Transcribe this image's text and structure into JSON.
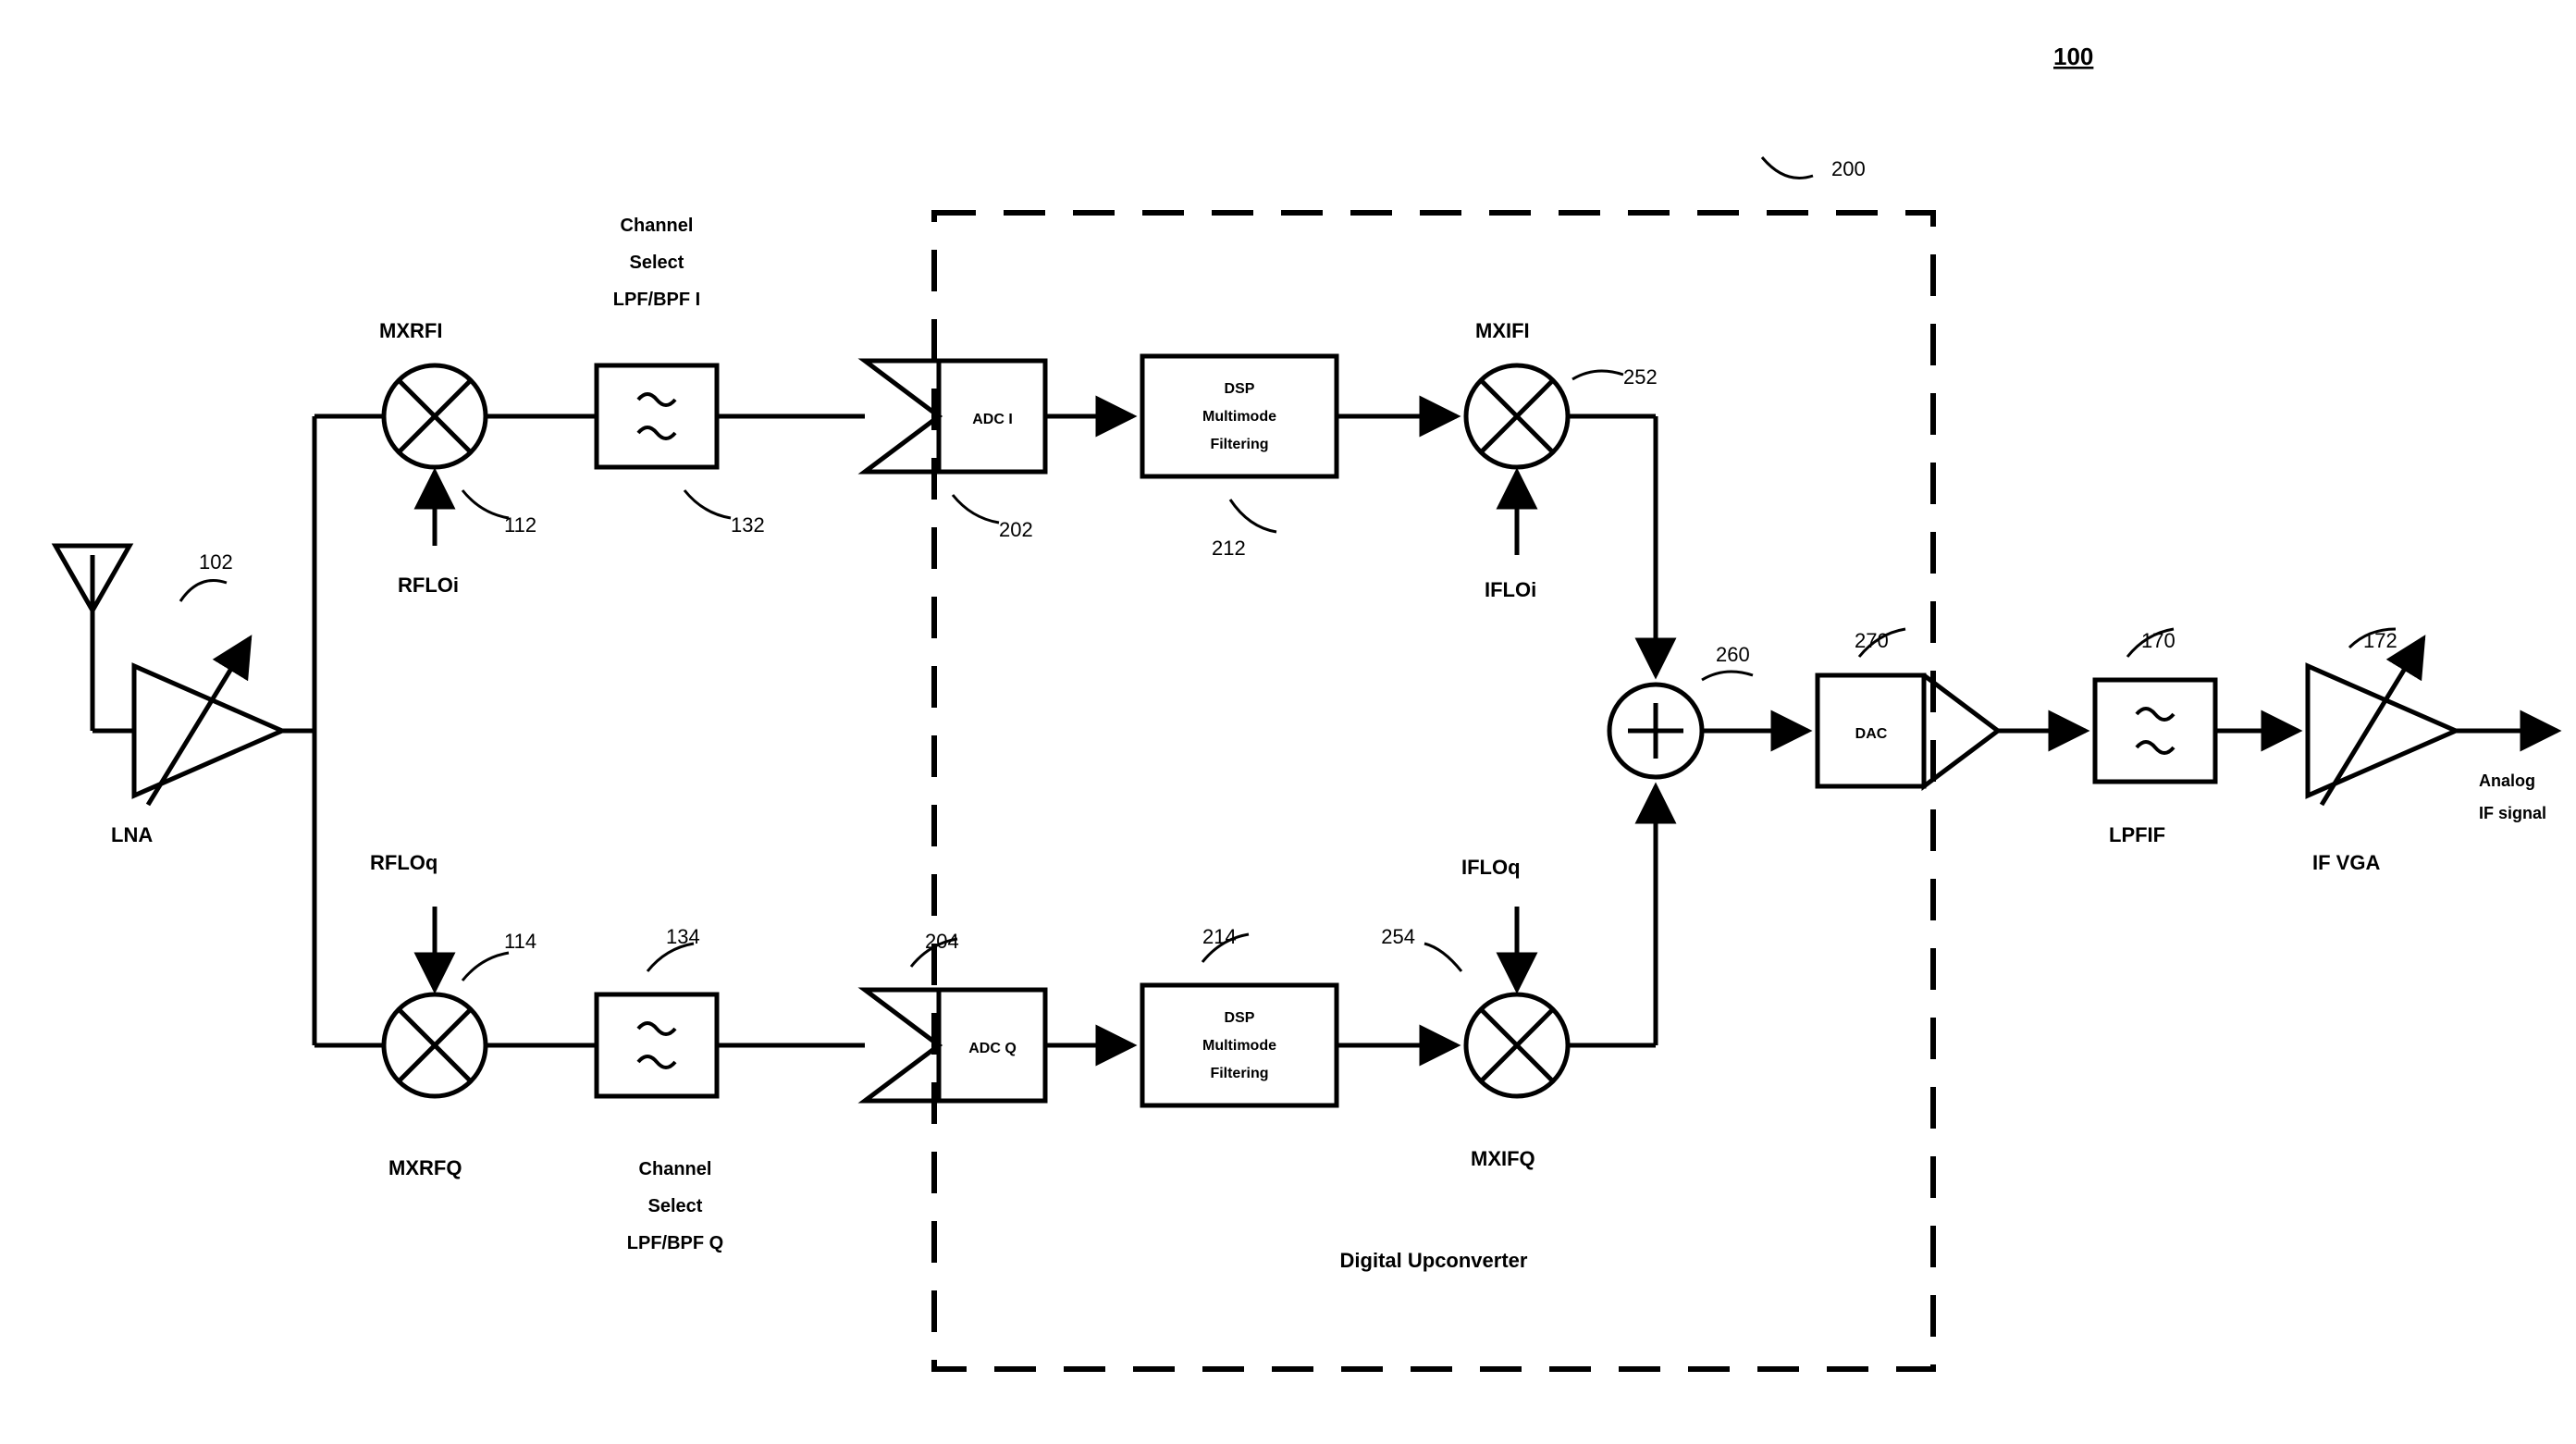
{
  "figure_ref": "100",
  "dashed_ref": "200",
  "section_title": "Digital Upconverter",
  "antenna": {
    "ref": "102"
  },
  "lna": {
    "label": "LNA"
  },
  "mixers": {
    "rfi": {
      "label": "MXRFI",
      "ref": "112",
      "lo": "RFLOi"
    },
    "rfq": {
      "label": "MXRFQ",
      "ref": "114",
      "lo": "RFLOq"
    },
    "ifi": {
      "label": "MXIFI",
      "ref": "252",
      "lo": "IFLOi"
    },
    "ifq": {
      "label": "MXIFQ",
      "ref": "254",
      "lo": "IFLOq"
    }
  },
  "filters": {
    "csi": {
      "label1": "Channel",
      "label2": "Select",
      "label3": "LPF/BPF I",
      "ref": "132"
    },
    "csq": {
      "label1": "Channel",
      "label2": "Select",
      "label3": "LPF/BPF Q",
      "ref": "134"
    }
  },
  "adc": {
    "i": {
      "label": "ADC I",
      "ref": "202"
    },
    "q": {
      "label": "ADC Q",
      "ref": "204"
    }
  },
  "dsp": {
    "i": {
      "label1": "DSP",
      "label2": "Multimode",
      "label3": "Filtering",
      "ref": "212"
    },
    "q": {
      "label1": "DSP",
      "label2": "Multimode",
      "label3": "Filtering",
      "ref": "214"
    }
  },
  "summer": {
    "ref": "260"
  },
  "dac": {
    "label": "DAC",
    "ref": "270"
  },
  "lpfif": {
    "label": "LPFIF",
    "ref": "170"
  },
  "vga": {
    "label": "IF VGA",
    "ref": "172"
  },
  "output": {
    "line1": "Analog",
    "line2": "IF signal"
  }
}
